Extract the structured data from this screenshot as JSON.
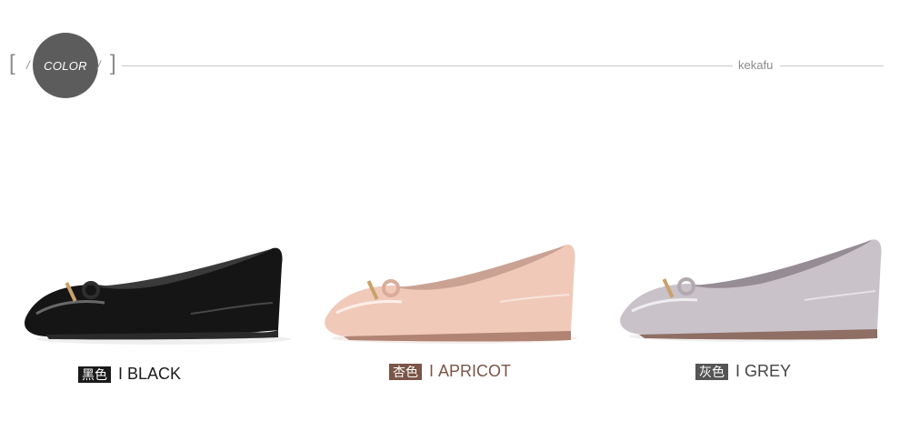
{
  "header": {
    "badge_label": "COLOR",
    "bracket_left": "[",
    "bracket_right": "]",
    "slash": "/",
    "brand": "kekafu"
  },
  "colors": {
    "badge_bg": "#5c5c5c",
    "black_shoe": "#1a1a1a",
    "apricot_shoe": "#f2c8b8",
    "grey_shoe": "#c9c2c8"
  },
  "variants": [
    {
      "cn": "黑色",
      "separator": "I",
      "en": "BLACK",
      "tag_color": "#1a1a1a",
      "text_color": "#1a1a1a"
    },
    {
      "cn": "杏色",
      "separator": "I",
      "en": "APRICOT",
      "tag_color": "#7a5548",
      "text_color": "#7a5548"
    },
    {
      "cn": "灰色",
      "separator": "I",
      "en": "GREY",
      "tag_color": "#555555",
      "text_color": "#444444"
    }
  ]
}
